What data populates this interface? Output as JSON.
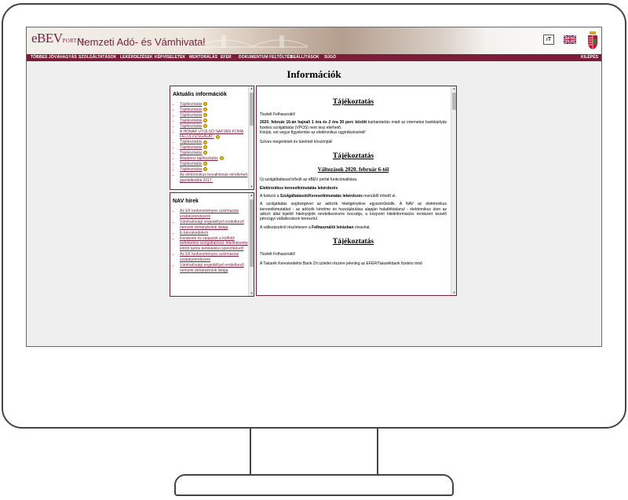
{
  "header": {
    "logo_main": "eBEV",
    "logo_sub": "PORTÁL",
    "title": "Nemzeti Adó- és Vámhivatal",
    "text_size_label": "ıT",
    "icons": {
      "flag": "uk-flag-icon",
      "crest": "hungarian-crest-icon",
      "text_size": "text-size-icon"
    }
  },
  "menu": {
    "items": [
      "TÖBBES JÓVÁHAGYÁS",
      "SZOLGÁLTATÁSOK",
      "LEKÉRDEZÉSEK",
      "KÉPVISELETEK",
      "MENTORÁLÁS",
      "EFER",
      "DOKUMENTUM FELTÖLTÉS",
      "BEÁLLÍTÁSOK",
      "SÚGÓ"
    ],
    "logout": "KILÉPÉS"
  },
  "page_title": "Információk",
  "current_info": {
    "heading": "Aktuális információk",
    "items": [
      {
        "label": "Tájékoztatás",
        "warn": true
      },
      {
        "label": "Tájékoztatás",
        "warn": true
      },
      {
        "label": "Tájékoztatás",
        "warn": true
      },
      {
        "label": "Tájékoztatás",
        "warn": true
      },
      {
        "label": "Tájékoztatás",
        "warn": true
      },
      {
        "label": "A HÓNAP UTOLSÓ NAPJÁN KOMA FELÜLVIZSGÁLAT!",
        "warn": true
      },
      {
        "label": "Tájékoztatás",
        "warn": true
      },
      {
        "label": "Tájékoztatás",
        "warn": true
      },
      {
        "label": "Tájékoztatás",
        "warn": true
      },
      {
        "label": "Általános tájékoztatás",
        "warn": true
      },
      {
        "label": "Tájékoztatás",
        "warn": true
      },
      {
        "label": "Tájékoztatás",
        "warn": true
      },
      {
        "label": "Az elektronikus bevallóknak mindlehett gazdálkodók 2017.",
        "warn": false
      }
    ]
  },
  "nav_news": {
    "heading": "NAV hírek",
    "items": [
      "Az EK kedvezményes származási szabályrendszere",
      "Vámhatósági engedéllyel rendelkező nemzeti dohánybolok listája",
      "E-kereskedelem",
      "Kérdések és válaszok a külföldi befektetési szolgáltatóval, hitelintézettel kötött tartós befektetési szerződésről",
      "Az EK kedvezményes származási szabályrendszere",
      "Vámhatósági engedéllyel rendelkező nemzeti dohánybolok listája"
    ]
  },
  "main": {
    "block1": {
      "heading": "Tájékoztatás",
      "greeting": "Tisztelt Felhasználó!",
      "p1_bold": "2020. február 16-án hajnali 1 óra és 2 óra 30 perc között",
      "p1_rest": " karbantartás miatt az internetes bankkártyás fizetési szolgáltatás (VPOS) nem lesz elérhető.",
      "p1_line2": "Kérjük, ezt vegye figyelembe az elektronikus ügyintézésénél!",
      "p2": "Szíves megértését és türelmét köszönjük!"
    },
    "block2": {
      "heading": "Tájékoztatás",
      "subheading": "Változások 2020. február 6-tól",
      "p1": "Új szolgáltatással bővült az eBEV portál funkcionalitása.",
      "p2_bold": "Elektronikus keresetkimutatás lekérdezés",
      "p3_pre": "A funkció a ",
      "p3_bold": "Szolgáltatások/Keresetkimutatás lekérdezés",
      "p3_post": " menüből érhető el.",
      "p4": "A szolgáltatás segítségével az adózók hiteligénylése egyszerűsödik. A NAV az elektronikus keresetkimutatást - az adózók kérelme és hozzájárulása alapján haladéktalanul - elektronikus úton az adózó által kijelölt hitelnyújtók rendelkezésére bocsátja, a központi hitelinformációs rendszert kezelő pénzügyi vállalkozáson keresztül.",
      "p5_pre": "A változásokról részletesen a ",
      "p5_bold": "Felhasználói leírásban",
      "p5_post": " olvashat."
    },
    "block3": {
      "heading": "Tájékoztatás",
      "greeting": "Tisztelt Felhasználó!",
      "p1": "A Takarék Kereskedelmi Bank Zrt üzletlei részére jelenleg az EFER/Takarékbank fizetési mód"
    }
  },
  "colors": {
    "brand": "#7c1d3a",
    "background": "#efefef"
  }
}
